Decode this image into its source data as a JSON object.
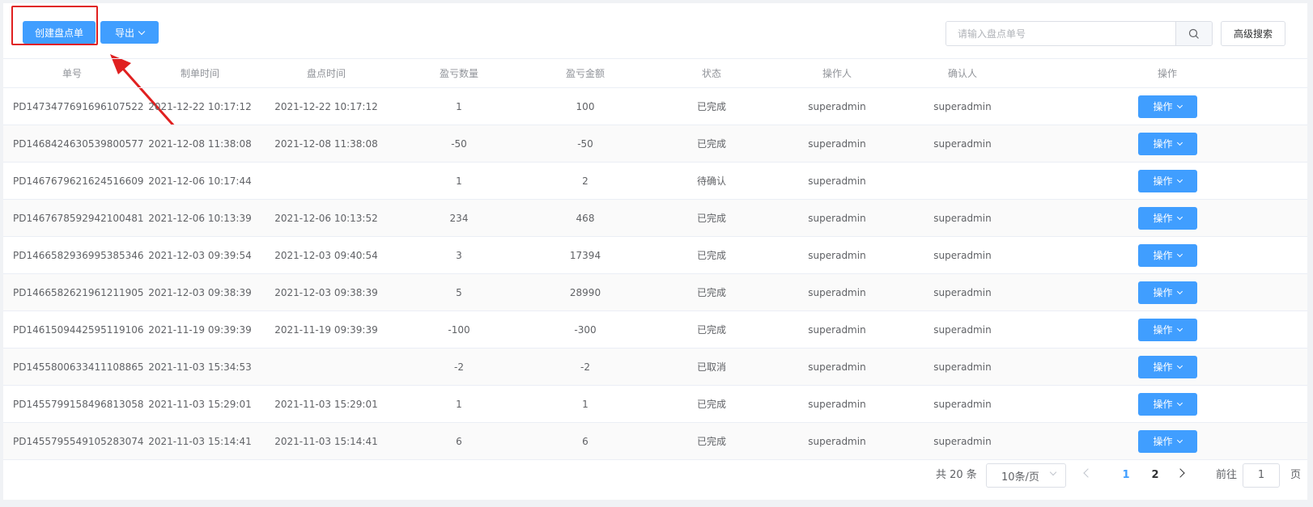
{
  "toolbar": {
    "create_label": "创建盘点单",
    "export_label": "导出",
    "search_placeholder": "请输入盘点单号",
    "advanced_label": "高级搜索"
  },
  "table": {
    "headers": [
      "单号",
      "制单时间",
      "盘点时间",
      "盈亏数量",
      "盈亏金额",
      "状态",
      "操作人",
      "确认人",
      "操作"
    ],
    "action_label": "操作",
    "rows": [
      [
        "PD1473477691696107522",
        "2021-12-22 10:17:12",
        "2021-12-22 10:17:12",
        "1",
        "100",
        "已完成",
        "superadmin",
        "superadmin"
      ],
      [
        "PD1468424630539800577",
        "2021-12-08 11:38:08",
        "2021-12-08 11:38:08",
        "-50",
        "-50",
        "已完成",
        "superadmin",
        "superadmin"
      ],
      [
        "PD1467679621624516609",
        "2021-12-06 10:17:44",
        "",
        "1",
        "2",
        "待确认",
        "superadmin",
        ""
      ],
      [
        "PD1467678592942100481",
        "2021-12-06 10:13:39",
        "2021-12-06 10:13:52",
        "234",
        "468",
        "已完成",
        "superadmin",
        "superadmin"
      ],
      [
        "PD1466582936995385346",
        "2021-12-03 09:39:54",
        "2021-12-03 09:40:54",
        "3",
        "17394",
        "已完成",
        "superadmin",
        "superadmin"
      ],
      [
        "PD1466582621961211905",
        "2021-12-03 09:38:39",
        "2021-12-03 09:38:39",
        "5",
        "28990",
        "已完成",
        "superadmin",
        "superadmin"
      ],
      [
        "PD1461509442595119106",
        "2021-11-19 09:39:39",
        "2021-11-19 09:39:39",
        "-100",
        "-300",
        "已完成",
        "superadmin",
        "superadmin"
      ],
      [
        "PD1455800633411108865",
        "2021-11-03 15:34:53",
        "",
        "-2",
        "-2",
        "已取消",
        "superadmin",
        "superadmin"
      ],
      [
        "PD1455799158496813058",
        "2021-11-03 15:29:01",
        "2021-11-03 15:29:01",
        "1",
        "1",
        "已完成",
        "superadmin",
        "superadmin"
      ],
      [
        "PD1455795549105283074",
        "2021-11-03 15:14:41",
        "2021-11-03 15:14:41",
        "6",
        "6",
        "已完成",
        "superadmin",
        "superadmin"
      ]
    ]
  },
  "pagination": {
    "total": "共 20 条",
    "page_size": "10条/页",
    "pages": [
      "1",
      "2"
    ],
    "current_page": "1",
    "goto_label": "前往",
    "goto_value": "1",
    "page_unit": "页"
  },
  "colors": {
    "primary": "#409eff",
    "annotation": "#e02020"
  }
}
